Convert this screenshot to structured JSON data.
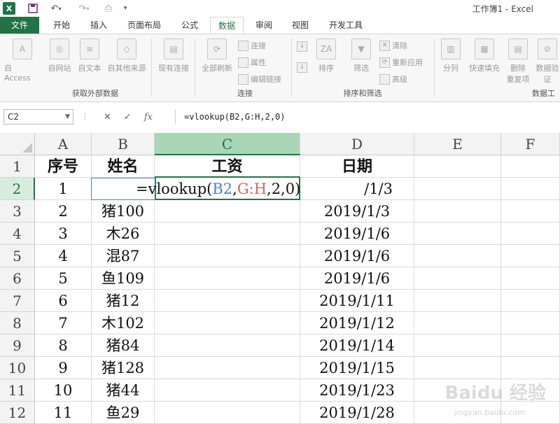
{
  "window": {
    "title": "工作簿1 - Excel"
  },
  "tabs": [
    "文件",
    "开始",
    "插入",
    "页面布局",
    "公式",
    "数据",
    "审阅",
    "视图",
    "开发工具"
  ],
  "active_tab": "数据",
  "ribbon": {
    "external_data": {
      "label": "获取外部数据",
      "buttons": [
        "自 Access",
        "自网站",
        "自文本",
        "自其他来源",
        "现有连接"
      ]
    },
    "connections": {
      "label": "连接",
      "refresh_all": "全部刷新",
      "items": [
        "连接",
        "属性",
        "编辑链接"
      ]
    },
    "sort_filter": {
      "label": "排序和筛选",
      "sort": "排序",
      "filter": "筛选",
      "items": [
        "清除",
        "重新应用",
        "高级"
      ]
    },
    "data_tools": {
      "label": "数据工",
      "buttons": [
        "分列",
        "快速填充",
        "删除\n重复项",
        "数据验\n证"
      ]
    }
  },
  "formula_bar": {
    "name_box": "C2",
    "formula": "=vlookup(B2,G:H,2,0)"
  },
  "columns": [
    "A",
    "B",
    "C",
    "D",
    "E",
    "F"
  ],
  "rows": [
    "1",
    "2",
    "3",
    "4",
    "5",
    "6",
    "7",
    "8",
    "9",
    "10",
    "11",
    "12"
  ],
  "headers": {
    "A": "序号",
    "B": "姓名",
    "C": "工资",
    "D": "日期"
  },
  "data_rows": [
    {
      "A": "1",
      "B": "",
      "D": "/1/3"
    },
    {
      "A": "2",
      "B": "猪100",
      "D": "2019/1/3"
    },
    {
      "A": "3",
      "B": "木26",
      "D": "2019/1/6"
    },
    {
      "A": "4",
      "B": "混87",
      "D": "2019/1/6"
    },
    {
      "A": "5",
      "B": "鱼109",
      "D": "2019/1/6"
    },
    {
      "A": "6",
      "B": "猪12",
      "D": "2019/1/11"
    },
    {
      "A": "7",
      "B": "木102",
      "D": "2019/1/12"
    },
    {
      "A": "8",
      "B": "猪84",
      "D": "2019/1/14"
    },
    {
      "A": "9",
      "B": "猪128",
      "D": "2019/1/15"
    },
    {
      "A": "10",
      "B": "猪44",
      "D": "2019/1/23"
    },
    {
      "A": "11",
      "B": "鱼29",
      "D": "2019/1/28"
    }
  ],
  "editing": {
    "prefix": "=vlookup(",
    "ref1": "B2",
    "sep1": ",",
    "ref2": "G:H",
    "suffix": ",2,0)"
  },
  "watermark": {
    "main": "Baidu 经验",
    "sub": "jingyan.baidu.com"
  },
  "colors": {
    "excel_green": "#217346",
    "ref_blue": "#4f81c7",
    "ref_red": "#e06060"
  }
}
